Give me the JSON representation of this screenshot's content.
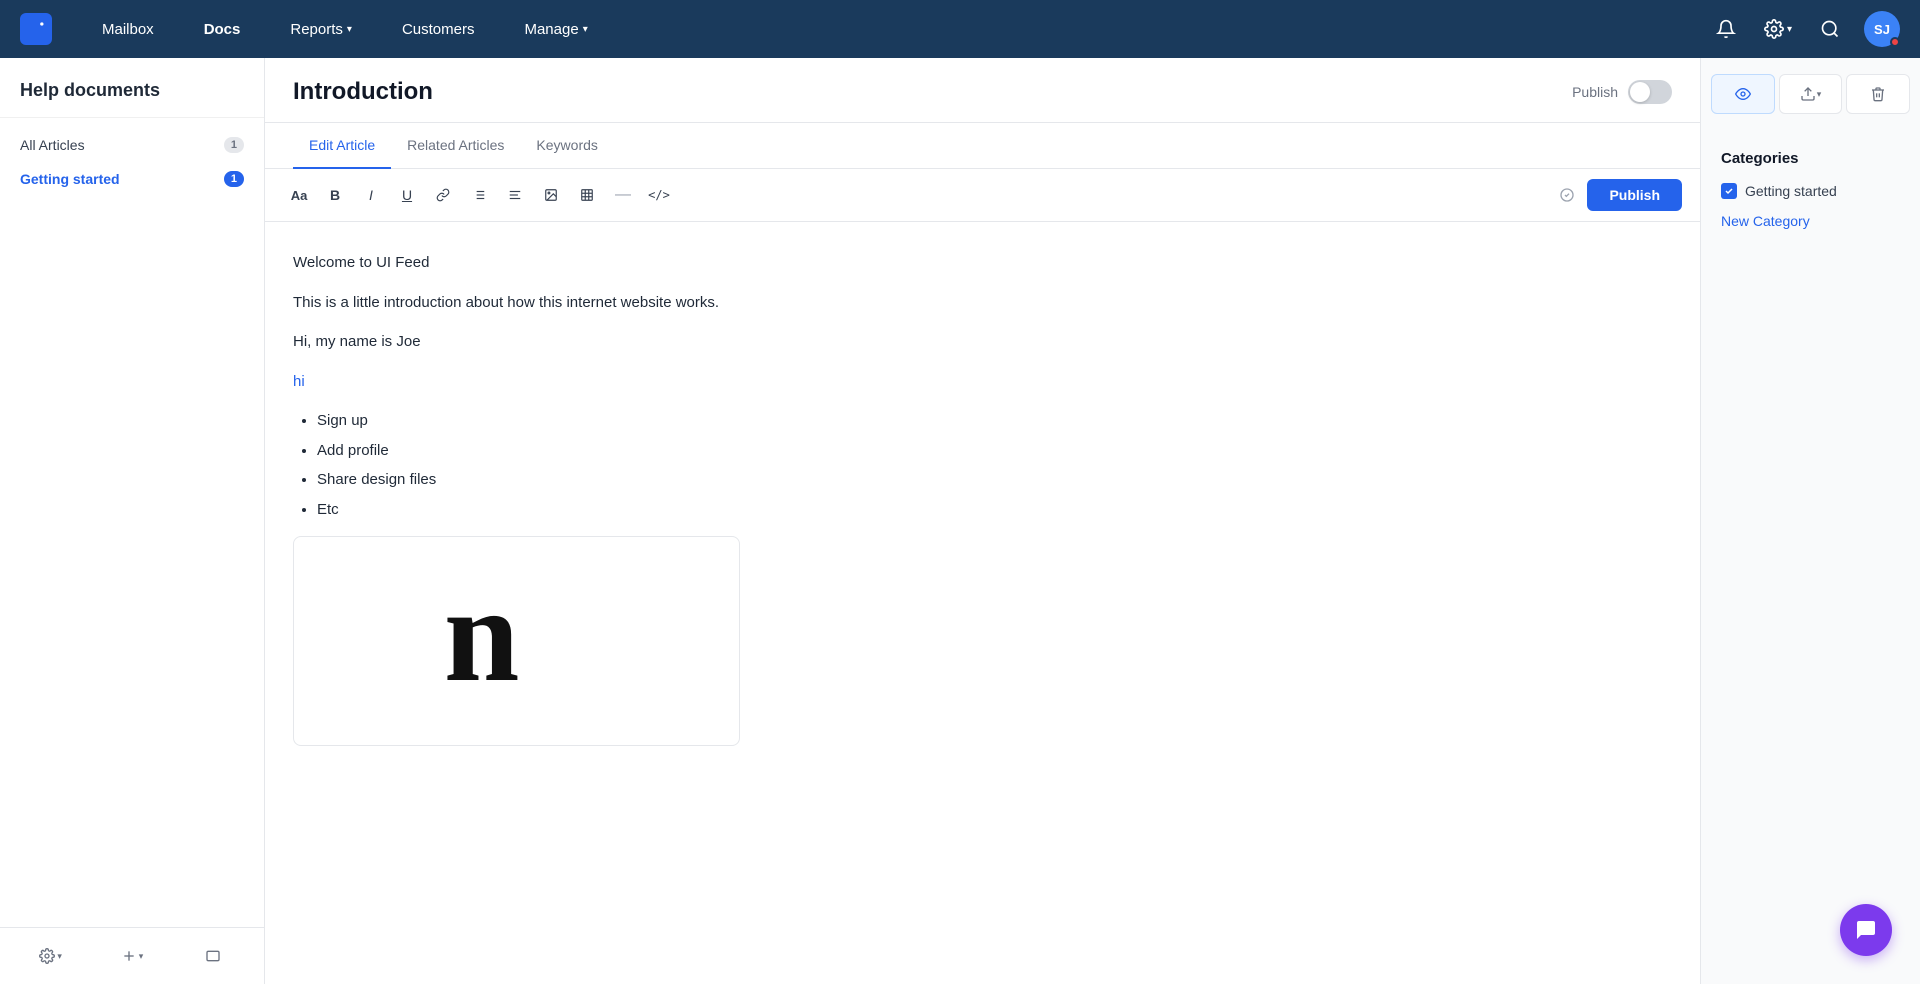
{
  "app": {
    "logo_label": "UI Feed logo"
  },
  "topnav": {
    "items": [
      {
        "id": "mailbox",
        "label": "Mailbox",
        "active": false,
        "has_dropdown": false
      },
      {
        "id": "docs",
        "label": "Docs",
        "active": true,
        "has_dropdown": false
      },
      {
        "id": "reports",
        "label": "Reports",
        "active": false,
        "has_dropdown": true
      },
      {
        "id": "customers",
        "label": "Customers",
        "active": false,
        "has_dropdown": false
      },
      {
        "id": "manage",
        "label": "Manage",
        "active": false,
        "has_dropdown": true
      }
    ],
    "avatar_initials": "SJ",
    "avatar_color": "#3b82f6"
  },
  "sidebar": {
    "title": "Help documents",
    "items": [
      {
        "id": "all-articles",
        "label": "All Articles",
        "count": 1,
        "active": false
      },
      {
        "id": "getting-started",
        "label": "Getting started",
        "count": 1,
        "active": true
      }
    ],
    "footer_buttons": [
      {
        "id": "settings",
        "icon": "⚙",
        "label": "Settings"
      },
      {
        "id": "add",
        "icon": "+",
        "label": "Add"
      },
      {
        "id": "preview",
        "icon": "▭",
        "label": "Preview"
      }
    ]
  },
  "article": {
    "title": "Introduction",
    "publish_label": "Publish",
    "tabs": [
      {
        "id": "edit",
        "label": "Edit Article",
        "active": true
      },
      {
        "id": "related",
        "label": "Related Articles",
        "active": false
      },
      {
        "id": "keywords",
        "label": "Keywords",
        "active": false
      }
    ],
    "toolbar": {
      "publish_btn": "Publish",
      "buttons": [
        "Aa",
        "B",
        "I",
        "U",
        "🔗",
        "≡",
        "≡",
        "⊞",
        "—",
        "</>"
      ]
    },
    "content": {
      "heading": "Welcome to UI Feed",
      "para1": "This is a little introduction about how this internet website works.",
      "para2": "Hi, my name is Joe",
      "link_text": "hi",
      "list_items": [
        "Sign up",
        "Add profile",
        "Share design files",
        "Etc"
      ]
    }
  },
  "right_panel": {
    "categories_title": "Categories",
    "categories": [
      {
        "id": "getting-started",
        "label": "Getting started",
        "checked": true
      }
    ],
    "new_category_label": "New Category",
    "action_buttons": [
      {
        "id": "view",
        "icon": "👁",
        "active": true
      },
      {
        "id": "export",
        "icon": "↗",
        "active": false
      },
      {
        "id": "delete",
        "icon": "🗑",
        "active": false
      }
    ]
  },
  "chat_fab": {
    "icon": "💬"
  }
}
